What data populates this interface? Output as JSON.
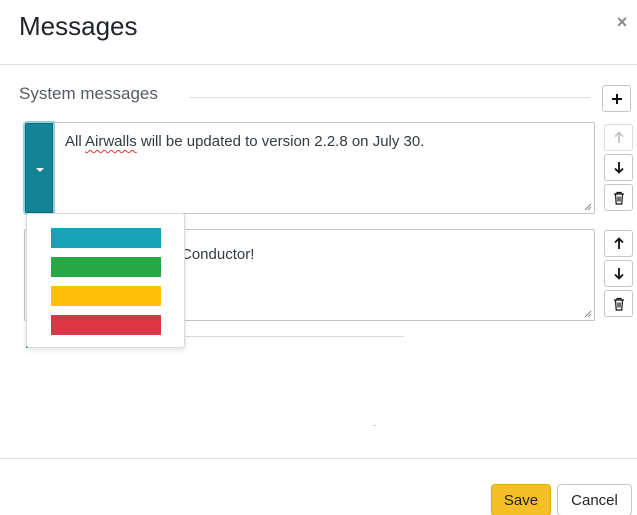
{
  "modal": {
    "title": "Messages",
    "close_glyph": "×",
    "close_icon": "close-icon"
  },
  "section": {
    "title": "System messages",
    "add_icon": "plus-icon"
  },
  "messages": [
    {
      "text_before": "All ",
      "text_misspelled": "Airwalls",
      "text_after": " will be updated to version 2.2.8 on July 30.",
      "tab_color": "#138496",
      "move_up_disabled": true
    },
    {
      "text_visible": "Conductor!",
      "tab_color": "#28a745",
      "move_up_disabled": false
    }
  ],
  "color_options": [
    {
      "name": "info",
      "color": "#17a2b8"
    },
    {
      "name": "success",
      "color": "#28a745"
    },
    {
      "name": "warning",
      "color": "#ffc107"
    },
    {
      "name": "danger",
      "color": "#dc3545"
    }
  ],
  "footer": {
    "save_label": "Save",
    "cancel_label": "Cancel",
    "save_color": "#f6bf26"
  }
}
